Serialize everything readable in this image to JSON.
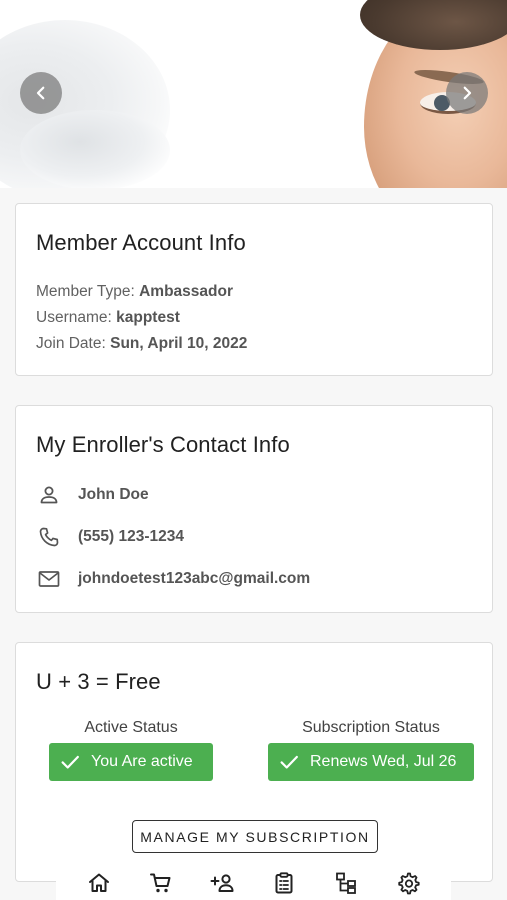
{
  "carousel": {
    "prev_icon": "chevron-left-icon",
    "next_icon": "chevron-right-icon"
  },
  "member_account": {
    "title": "Member Account Info",
    "member_type_label": "Member Type: ",
    "member_type_value": "Ambassador",
    "username_label": "Username: ",
    "username_value": "kapptest",
    "join_date_label": "Join Date: ",
    "join_date_value": "Sun, April 10, 2022"
  },
  "enroller_contact": {
    "title": "My Enroller's Contact Info",
    "name": "John Doe",
    "phone": "(555) 123-1234",
    "email": "johndoetest123abc@gmail.com",
    "icons": [
      "person-icon",
      "phone-icon",
      "mail-icon"
    ]
  },
  "plan": {
    "title": "U + 3 = Free",
    "active_status_label": "Active Status",
    "active_status_value": "You Are active",
    "subscription_status_label": "Subscription Status",
    "subscription_status_value": "Renews Wed, Jul 26",
    "manage_button": "MANAGE MY SUBSCRIPTION"
  },
  "bottom_nav": {
    "items": [
      "home-icon",
      "cart-icon",
      "add-person-icon",
      "clipboard-icon",
      "hierarchy-icon",
      "settings-icon"
    ]
  },
  "colors": {
    "success": "#4caf50",
    "card_border": "#dcdcdc",
    "page_background": "#f7f7f7"
  }
}
